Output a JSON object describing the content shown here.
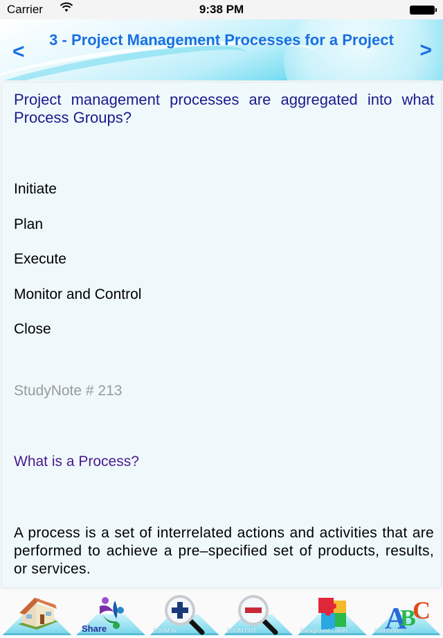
{
  "status_bar": {
    "carrier": "Carrier",
    "time": "9:38 PM"
  },
  "header": {
    "title": "3 - Project Management Processes for a Project",
    "prev_label": "<",
    "next_label": ">"
  },
  "content": {
    "question": "Project management processes are aggregated into what Process Groups?",
    "options": [
      "Initiate",
      "Plan",
      "Execute",
      "Monitor and Control",
      "Close"
    ],
    "note": "StudyNote # 213",
    "subheading": "What is a Process?",
    "answer": "A process is a set of interrelated actions and activities that are performed to achieve a pre–specified set of products, results, or services."
  },
  "toolbar": {
    "items": [
      {
        "id": "home",
        "label": "",
        "icon": "house-icon"
      },
      {
        "id": "share",
        "label": "Share",
        "icon": "share-people-icon"
      },
      {
        "id": "zoom-in",
        "label": "ZOOM IN",
        "icon": "zoom-in-icon"
      },
      {
        "id": "zoom-out",
        "label": "ZOOM OUT",
        "icon": "zoom-out-icon"
      },
      {
        "id": "background-colors",
        "label": "Background Colors",
        "icon": "puzzle-icon"
      },
      {
        "id": "font-colors",
        "label": "Font Colors",
        "icon": "abc-blocks-icon"
      }
    ]
  },
  "colors": {
    "title": "#1a6fe0",
    "question": "#1a1a8c",
    "subheading": "#4a1a8c",
    "note": "#9a9a9a",
    "content_bg": "#eff9fb"
  }
}
